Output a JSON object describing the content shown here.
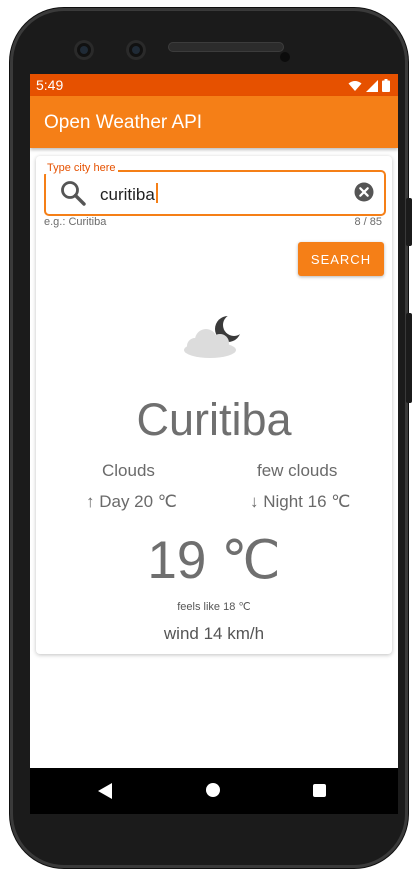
{
  "status_bar": {
    "time": "5:49"
  },
  "app_bar": {
    "title": "Open Weather API"
  },
  "search": {
    "label": "Type city here",
    "value": "curitiba",
    "helper": "e.g.: Curitiba",
    "counter": "8 / 85",
    "button_label": "SEARCH"
  },
  "weather": {
    "icon": "few-clouds-night-icon",
    "city": "Curitiba",
    "main": "Clouds",
    "description": "few clouds",
    "day": "↑ Day 20 ℃",
    "night": "↓ Night 16 ℃",
    "temperature": "19 ℃",
    "feels_like": "feels like 18 ℃",
    "wind": "wind 14 km/h"
  },
  "colors": {
    "status_bar": "#e65100",
    "app_bar": "#f57f17",
    "accent": "#f57f17"
  }
}
